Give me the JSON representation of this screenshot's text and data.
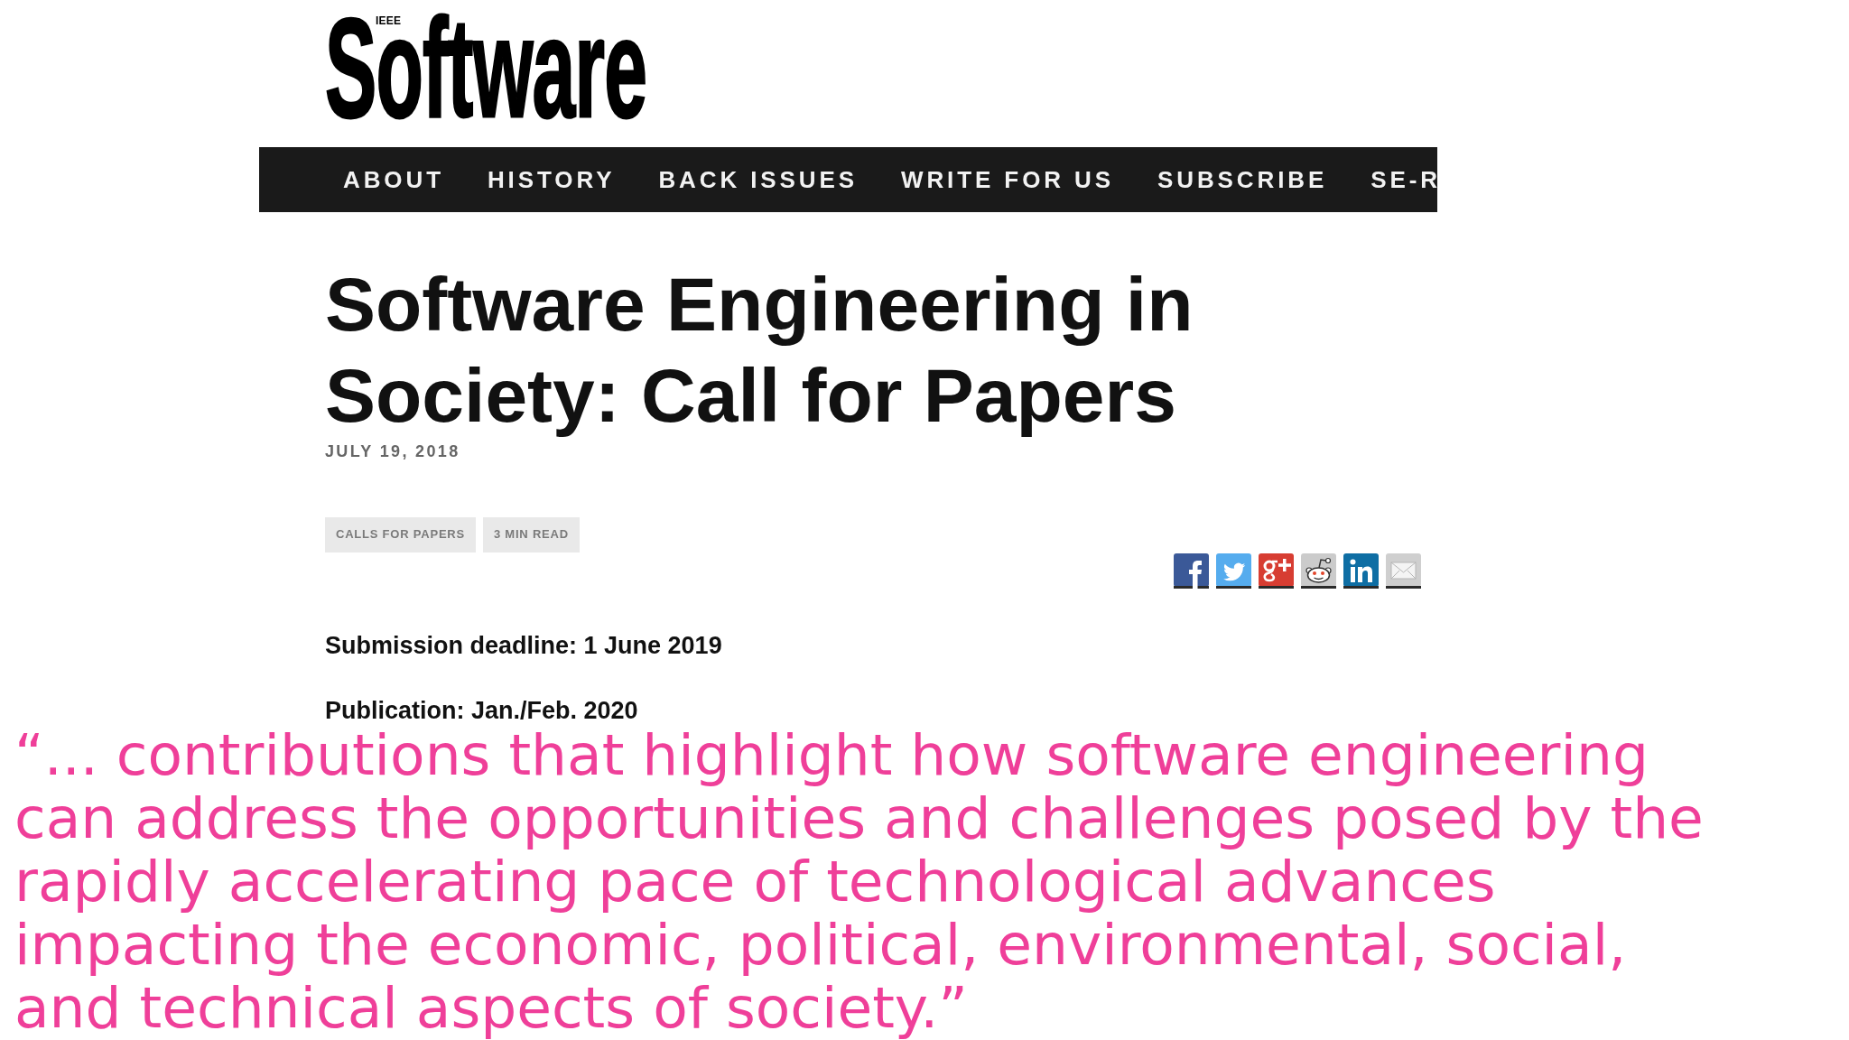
{
  "logo": {
    "superscript": "IEEE",
    "wordmark": "Software"
  },
  "nav": {
    "items": [
      "ABOUT",
      "HISTORY",
      "BACK ISSUES",
      "WRITE FOR US",
      "SUBSCRIBE",
      "SE-R"
    ]
  },
  "article": {
    "title": "Software Engineering in Society: Call for Papers",
    "date": "JULY 19, 2018",
    "tags": [
      "CALLS FOR PAPERS",
      "3 MIN READ"
    ],
    "details": [
      "Submission deadline: 1 June 2019",
      "Publication: Jan./Feb. 2020"
    ]
  },
  "quote": "“... contributions that highlight how software engineering can address the opportunities and challenges posed by the rapidly accelerating pace of technological advances impacting the economic, political, environmental, social, and technical aspects of society.”"
}
